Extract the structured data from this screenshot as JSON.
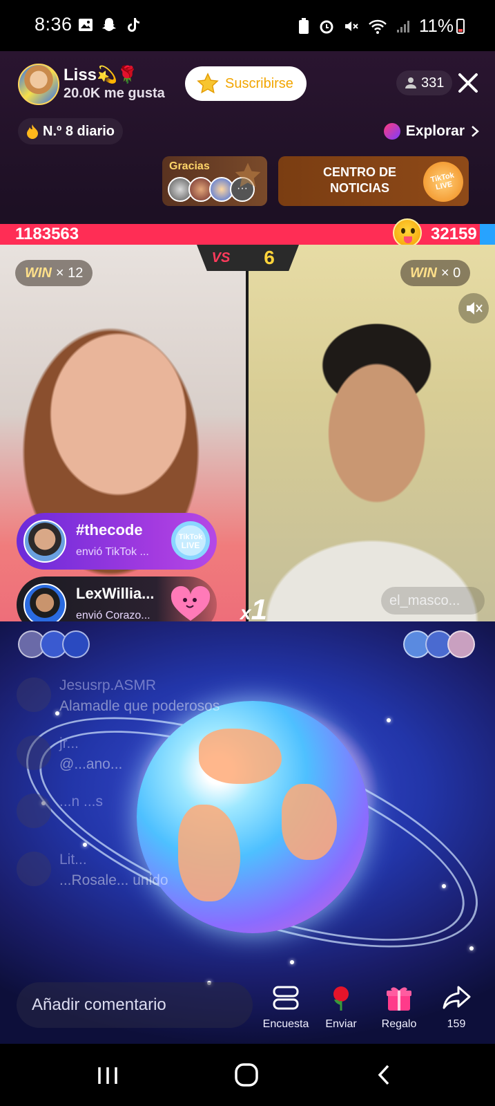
{
  "status_bar": {
    "time": "8:36",
    "battery": "11%",
    "icons": [
      "gallery-icon",
      "snapchat-icon",
      "tiktok-icon",
      "battery-saver-icon",
      "alarm-icon",
      "mute-icon",
      "wifi-icon",
      "signal-icon"
    ]
  },
  "host": {
    "name": "Liss💫🌹",
    "likes": "20.0K me gusta",
    "subscribe_label": "Suscribirse",
    "viewer_count": "331"
  },
  "rank": {
    "label": "N.º 8 diario"
  },
  "explore": {
    "label": "Explorar"
  },
  "gracias": {
    "title": "Gracias",
    "more": "···"
  },
  "news": {
    "label": "CENTRO DE NOTICIAS",
    "badge": "TikTok LIVE"
  },
  "battle": {
    "left_score": "1183563",
    "right_score": "32159",
    "vs_label": "VS",
    "timer": "6",
    "left_wins": {
      "win": "WIN",
      "count": "× 12"
    },
    "right_wins": {
      "win": "WIN",
      "count": "× 0"
    },
    "opponent_name": "el_masco..."
  },
  "gifts": [
    {
      "user": "#thecode",
      "text": "envió TikTok ...",
      "gift_icon": "tiktok-live-icon"
    },
    {
      "user": "LexWillia...",
      "text": "envió Corazo...",
      "gift_icon": "heart-character-icon"
    }
  ],
  "combo": {
    "prefix": "x",
    "count": "1"
  },
  "chat": [
    {
      "user": "Jesusrp.ASMR",
      "message": "Alamadle que poderosos"
    },
    {
      "user": "jr...",
      "message": "@...ano..."
    },
    {
      "user": "...n ...s",
      "message": ""
    },
    {
      "user": "Lit...",
      "message": "...Rosale... unido"
    }
  ],
  "bottom_bar": {
    "comment_placeholder": "Añadir comentario",
    "actions": [
      {
        "label": "Encuesta",
        "icon": "poll-icon"
      },
      {
        "label": "Enviar",
        "icon": "rose-icon"
      },
      {
        "label": "Regalo",
        "icon": "gift-icon"
      },
      {
        "label": "159",
        "icon": "share-icon"
      }
    ]
  },
  "colors": {
    "battle_red": "#ff2d55",
    "battle_blue": "#27a3ff",
    "subscribe_text": "#f2a500",
    "timer": "#ffd43b"
  }
}
